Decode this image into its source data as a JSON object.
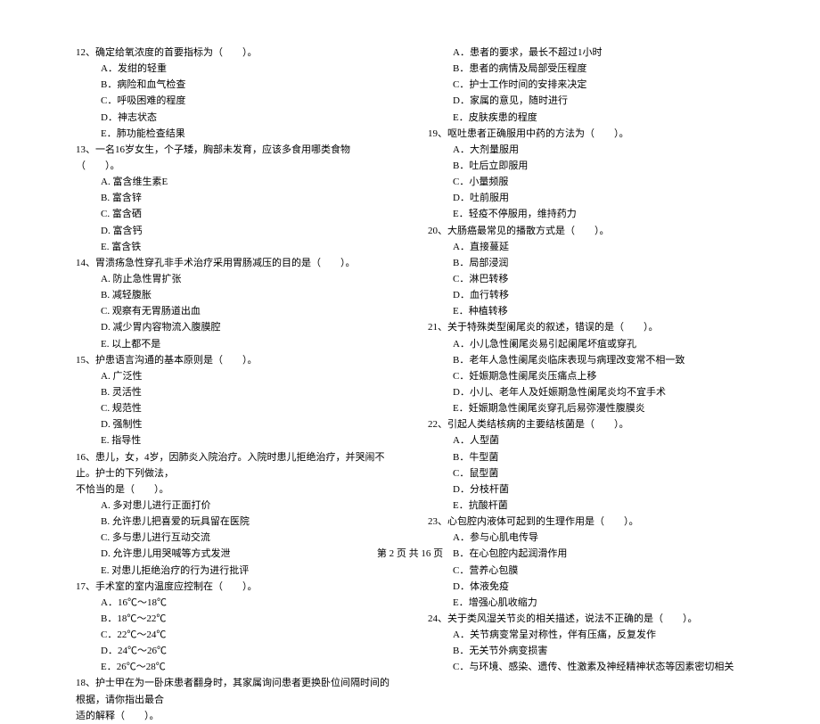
{
  "footer": "第 2 页 共 16 页",
  "left": {
    "q12": {
      "text": "12、确定给氧浓度的首要指标为（　　）。",
      "A": "A．发绀的轻重",
      "B": "B．病险和血气检查",
      "C": "C．呼吸困难的程度",
      "D": "D．神志状态",
      "E": "E．肺功能检查结果"
    },
    "q13": {
      "text": "13、一名16岁女生，个子矮，胸部未发育，应该多食用哪类食物（　　）。",
      "A": "A. 富含维生素E",
      "B": "B. 富含锌",
      "C": "C. 富含硒",
      "D": "D. 富含钙",
      "E": "E. 富含铁"
    },
    "q14": {
      "text": "14、胃溃疡急性穿孔非手术治疗采用胃肠减压的目的是（　　）。",
      "A": "A. 防止急性胃扩张",
      "B": "B. 减轻腹胀",
      "C": "C. 观察有无胃肠道出血",
      "D": "D. 减少胃内容物流入腹膜腔",
      "E": "E. 以上都不是"
    },
    "q15": {
      "text": "15、护患语言沟通的基本原则是（　　）。",
      "A": "A. 广泛性",
      "B": "B. 灵活性",
      "C": "C. 规范性",
      "D": "D. 强制性",
      "E": "E. 指导性"
    },
    "q16": {
      "text1": "16、患儿，女，4岁，因肺炎入院治疗。入院时患儿拒绝治疗，并哭闹不止。护士的下列做法，",
      "text2": "不恰当的是（　　）。",
      "A": "A. 多对患儿进行正面打价",
      "B": "B. 允许患儿把喜爱的玩具留在医院",
      "C": "C. 多与患儿进行互动交流",
      "D": "D. 允许患儿用哭喊等方式发泄",
      "E": "E. 对患儿拒绝治疗的行为进行批评"
    },
    "q17": {
      "text": "17、手术室的室内温度应控制在（　　）。",
      "A": "A．16℃～18℃",
      "B": "B．18℃～22℃",
      "C": "C．22℃～24℃",
      "D": "D．24℃～26℃",
      "E": "E．26℃～28℃"
    },
    "q18": {
      "text1": "18、护士甲在为一卧床患者翻身时，其家属询问患者更换卧位间隔时间的根据，请你指出最合",
      "text2": "适的解释（　　）。"
    }
  },
  "right": {
    "q18opts": {
      "A": "A．患者的要求，最长不超过1小时",
      "B": "B．患者的病情及局部受压程度",
      "C": "C．护士工作时间的安排来决定",
      "D": "D．家属的意见，随时进行",
      "E": "E．皮肤疾患的程度"
    },
    "q19": {
      "text": "19、呕吐患者正确服用中药的方法为（　　）。",
      "A": "A．大剂量服用",
      "B": "B．吐后立即服用",
      "C": "C．小量频服",
      "D": "D．吐前服用",
      "E": "E．轻疫不停服用，维持药力"
    },
    "q20": {
      "text": "20、大肠癌最常见的播散方式是（　　）。",
      "A": "A．直接蔓延",
      "B": "B．局部浸润",
      "C": "C．淋巴转移",
      "D": "D．血行转移",
      "E": "E．种植转移"
    },
    "q21": {
      "text": "21、关于特殊类型阑尾炎的叙述，错误的是（　　）。",
      "A": "A．小儿急性阑尾炎易引起阑尾坏疽或穿孔",
      "B": "B．老年人急性阑尾炎临床表现与病理改变常不相一致",
      "C": "C．妊娠期急性阑尾炎压痛点上移",
      "D": "D．小儿、老年人及妊娠期急性阑尾炎均不宜手术",
      "E": "E．妊娠期急性阑尾炎穿孔后易弥漫性腹膜炎"
    },
    "q22": {
      "text": "22、引起人类结核病的主要结核菌是（　　）。",
      "A": "A．人型菌",
      "B": "B．牛型菌",
      "C": "C．鼠型菌",
      "D": "D．分枝杆菌",
      "E": "E．抗酸杆菌"
    },
    "q23": {
      "text": "23、心包腔内液体可起到的生理作用是（　　）。",
      "A": "A．参与心肌电传导",
      "B": "B．在心包腔内起润滑作用",
      "C": "C．营养心包膜",
      "D": "D．体液免疫",
      "E": "E．增强心肌收缩力"
    },
    "q24": {
      "text": "24、关于类风湿关节炎的相关描述，说法不正确的是（　　）。",
      "A": "A．关节病变常呈对称性，伴有压痛，反复发作",
      "B": "B．无关节外病变损害",
      "C": "C．与环境、感染、遗传、性激素及神经精神状态等因素密切相关"
    }
  }
}
